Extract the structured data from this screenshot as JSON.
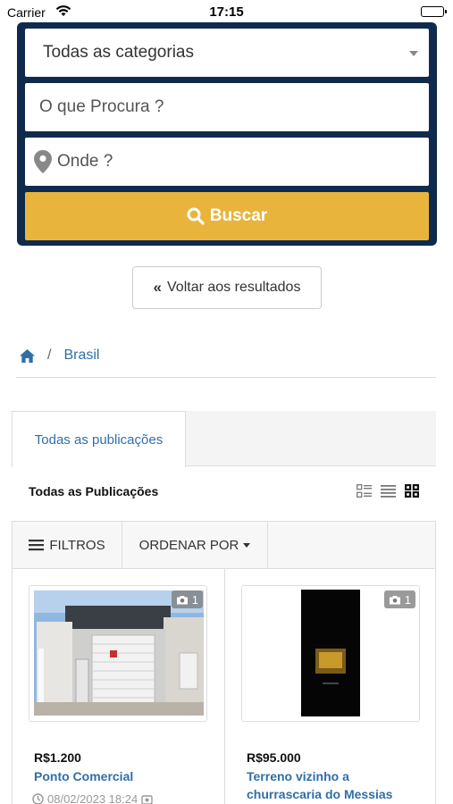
{
  "status_bar": {
    "carrier": "Carrier",
    "time": "17:15"
  },
  "search": {
    "category_selected": "Todas as categorias",
    "what_placeholder": "O que Procura ?",
    "where_placeholder": "Onde ?",
    "button_label": "Buscar"
  },
  "back_button": {
    "label": "Voltar aos resultados"
  },
  "breadcrumb": {
    "separator": "/",
    "current": "Brasil"
  },
  "tabs": [
    {
      "label": "Todas as publicações"
    }
  ],
  "section_title": "Todas as Publicações",
  "view_modes": [
    "list-thumb-icon",
    "list-icon",
    "grid-icon"
  ],
  "toolbar": {
    "filters_label": "FILTROS",
    "order_label": "ORDENAR POR"
  },
  "listings": [
    {
      "photo_count": "1",
      "price": "R$1.200",
      "title": "Ponto Comercial",
      "date": "08/02/2023 18:24"
    },
    {
      "photo_count": "1",
      "price": "R$95.000",
      "title": "Terreno vizinho a churrascaria do Messias",
      "date": ""
    }
  ],
  "colors": {
    "panel": "#0f2a4d",
    "accent": "#e9b43c",
    "link": "#2f6fa7"
  }
}
